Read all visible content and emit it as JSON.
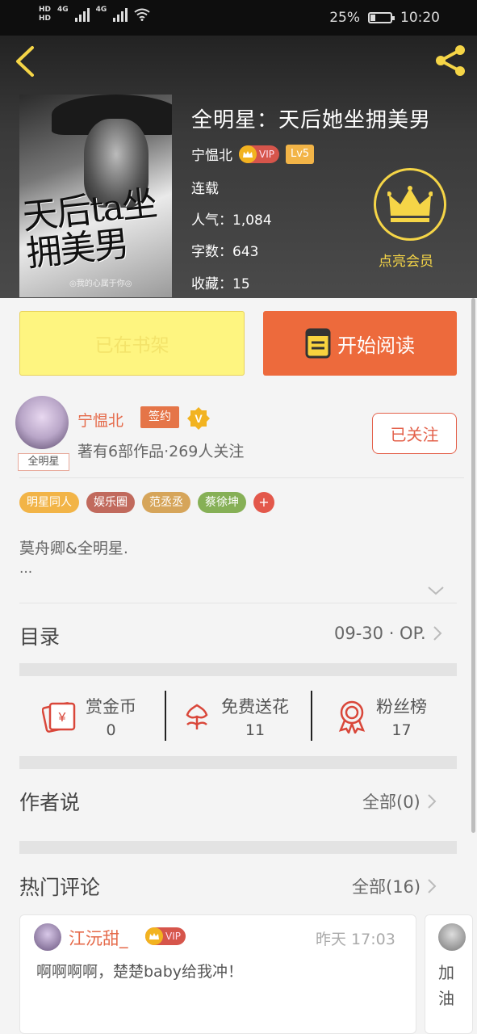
{
  "status_bar": {
    "hd1": "HD",
    "hd2": "HD",
    "net1": "4G",
    "net2": "4G",
    "battery_pct": "25%",
    "time": "10:20"
  },
  "book": {
    "title": "全明星：天后她坐拥美男",
    "author": "宁愠北",
    "vip_label": "VIP",
    "level": "Lv5",
    "status": "连载",
    "popularity_label": "人气：",
    "popularity": "1,084",
    "wordcount_label": "字数：",
    "wordcount": "643",
    "favorites_label": "收藏：",
    "favorites": "15",
    "cover": {
      "title_art": "天后ta坐拥美男",
      "tagline": "◎我的心属于你◎"
    }
  },
  "member": {
    "label": "点亮会员",
    "icon": "crown-icon",
    "color": "#f5d547"
  },
  "actions": {
    "shelf_label": "已在书架",
    "read_label": "开始阅读"
  },
  "author_card": {
    "name": "宁愠北",
    "sign_label": "签约",
    "verified_label": "V",
    "avatar_tag": "全明星",
    "stats": "著有6部作品·269人关注",
    "follow_label": "已关注"
  },
  "tags": [
    {
      "label": "明星同人",
      "color": "#f2b447"
    },
    {
      "label": "娱乐圈",
      "color": "#c16a5d"
    },
    {
      "label": "范丞丞",
      "color": "#d6a55a"
    },
    {
      "label": "蔡徐坤",
      "color": "#86b056"
    }
  ],
  "tag_add": "+",
  "intro": {
    "text": "莫舟卿&全明星.",
    "more": "..."
  },
  "catalog": {
    "title": "目录",
    "latest": "09-30 · OP."
  },
  "stats": [
    {
      "label": "赏金币",
      "value": "0",
      "icon": "coin-envelope-icon"
    },
    {
      "label": "免费送花",
      "value": "11",
      "icon": "flower-icon"
    },
    {
      "label": "粉丝榜",
      "value": "17",
      "icon": "medal-icon"
    }
  ],
  "author_says": {
    "title": "作者说",
    "all": "全部(0)"
  },
  "hot_comments": {
    "title": "热门评论",
    "all": "全部(16)",
    "items": [
      {
        "user": "江沅甜_",
        "vip": "VIP",
        "time": "昨天 17:03",
        "text": "啊啊啊啊，楚楚baby给我冲！"
      },
      {
        "user": "",
        "text": "加油"
      }
    ]
  },
  "colors": {
    "accent": "#ed6a3c",
    "author_name": "#e56a4a",
    "shelf_bg": "#fef580"
  }
}
